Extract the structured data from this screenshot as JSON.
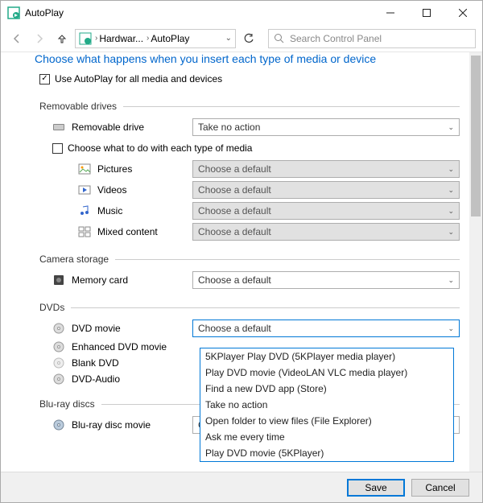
{
  "window": {
    "title": "AutoPlay"
  },
  "nav": {
    "crumb1": "Hardwar...",
    "crumb2": "AutoPlay",
    "search_placeholder": "Search Control Panel"
  },
  "header_truncated": "Choose what happens when you insert each type of media or device",
  "use_autoplay": "Use AutoPlay for all media and devices",
  "sections": {
    "removable": {
      "title": "Removable drives",
      "drive_label": "Removable drive",
      "drive_action": "Take no action",
      "choose_each": "Choose what to do with each type of media",
      "pictures": "Pictures",
      "videos": "Videos",
      "music": "Music",
      "mixed": "Mixed content",
      "default": "Choose a default"
    },
    "camera": {
      "title": "Camera storage",
      "memcard": "Memory card",
      "default": "Choose a default"
    },
    "dvds": {
      "title": "DVDs",
      "dvd_movie": "DVD movie",
      "enhanced": "Enhanced DVD movie",
      "blank": "Blank DVD",
      "audio": "DVD-Audio",
      "default": "Choose a default"
    },
    "bluray": {
      "title": "Blu-ray discs",
      "movie": "Blu-ray disc movie",
      "default": "Choose a default"
    }
  },
  "dropdown_options": [
    "5KPlayer Play DVD (5KPlayer media player)",
    "Play DVD movie (VideoLAN VLC media player)",
    "Find a new DVD app (Store)",
    "Take no action",
    "Open folder to view files (File Explorer)",
    "Ask me every time",
    "Play DVD movie (5KPlayer)"
  ],
  "footer": {
    "save": "Save",
    "cancel": "Cancel"
  }
}
